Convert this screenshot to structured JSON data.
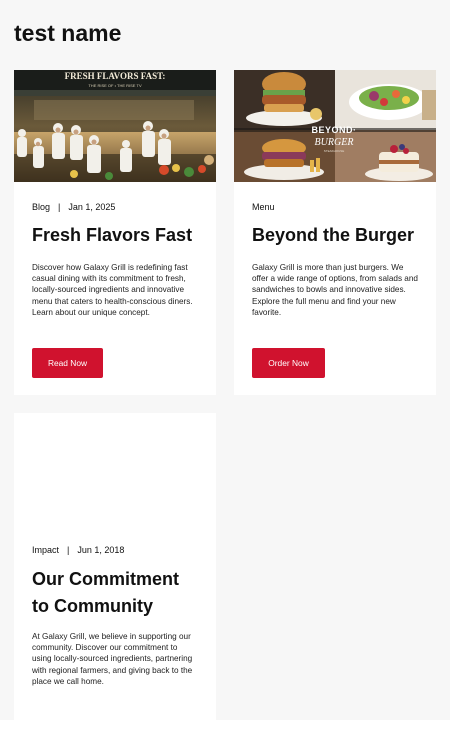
{
  "page": {
    "title": "test name"
  },
  "cards": [
    {
      "category": "Blog",
      "date": "Jan 1, 2025",
      "title": "Fresh Flavors Fast",
      "description": "Discover how Galaxy Grill is redefining fast casual dining with its commitment to fresh, locally-sourced ingredients and innovative menu that caters to health-conscious diners. Learn about our unique concept.",
      "button_label": "Read Now",
      "image": {
        "icon": "kitchen-photo",
        "sign_text": "FRESH FLAVORS FAST:",
        "sign_subtext": "THE RISE OF • THE RISE TV"
      }
    },
    {
      "category": "Menu",
      "date": "",
      "title": "Beyond the Burger",
      "description": "Galaxy Grill is more than just burgers. We offer a wide range of options, from salads and sandwiches to bowls and innovative sides. Explore the full menu and find your new favorite.",
      "button_label": "Order Now",
      "image": {
        "icon": "food-collage-photo",
        "logo_line1": "BEYOND·",
        "logo_line2": "BURGER",
        "logo_line3": "STEAKHOUSE"
      }
    },
    {
      "category": "Impact",
      "date": "Jun 1, 2018",
      "title": "Our Commitment to Community",
      "description": "At Galaxy Grill, we believe in supporting our community. Discover our commitment to using locally-sourced ingredients, partnering with regional farmers, and giving back to the place we call home.",
      "button_label": "",
      "image": null
    }
  ],
  "colors": {
    "accent": "#d0122e",
    "background": "#f7f7f7",
    "card": "#ffffff"
  }
}
